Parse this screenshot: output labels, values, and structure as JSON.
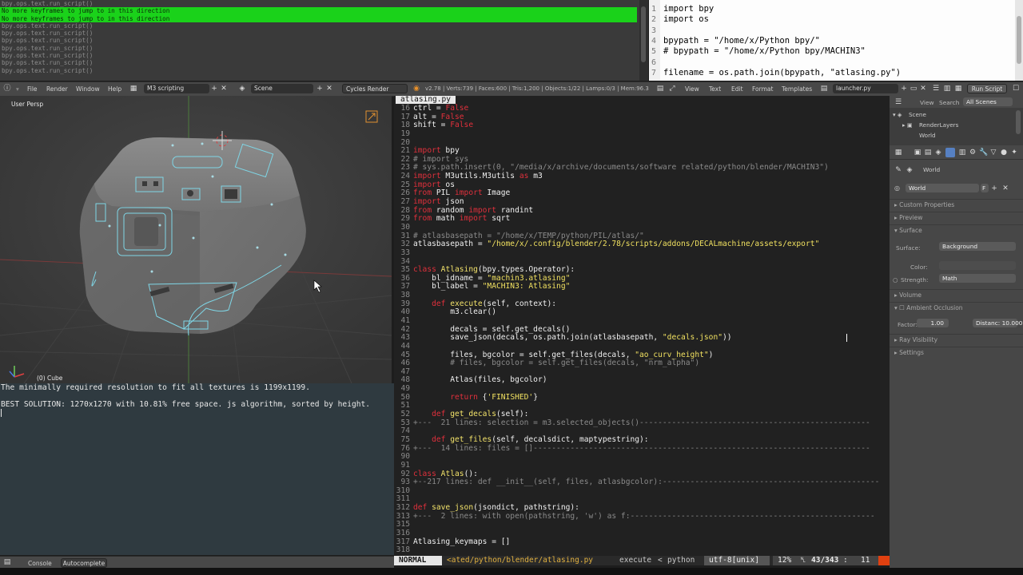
{
  "info_log": {
    "lines": [
      {
        "text": "bpy.ops.text.run_script()",
        "highlight": false
      },
      {
        "text": "No more keyframes to jump to in this direction",
        "highlight": true
      },
      {
        "text": "No more keyframes to jump to in this direction",
        "highlight": true
      },
      {
        "text": "bpy.ops.text.run_script()",
        "highlight": false
      },
      {
        "text": "bpy.ops.text.run_script()",
        "highlight": false
      },
      {
        "text": "bpy.ops.text.run_script()",
        "highlight": false
      },
      {
        "text": "bpy.ops.text.run_script()",
        "highlight": false
      },
      {
        "text": "bpy.ops.text.run_script()",
        "highlight": false
      },
      {
        "text": "bpy.ops.text.run_script()",
        "highlight": false
      },
      {
        "text": "bpy.ops.text.run_script()",
        "highlight": false
      }
    ]
  },
  "top_text_editor": {
    "lines": [
      {
        "num": "1",
        "code": "import bpy"
      },
      {
        "num": "2",
        "code": "import os"
      },
      {
        "num": "3",
        "code": ""
      },
      {
        "num": "4",
        "code": "bpypath = \"/home/x/Python bpy/\""
      },
      {
        "num": "5",
        "code": "# bpypath = \"/home/x/Python bpy/MACHIN3\""
      },
      {
        "num": "6",
        "code": ""
      },
      {
        "num": "7",
        "code": "filename = os.path.join(bpypath, \"atlasing.py\")"
      }
    ]
  },
  "header": {
    "file": "File",
    "render": "Render",
    "window": "Window",
    "help": "Help",
    "screen_layout": "M3 scripting",
    "scene": "Scene",
    "engine": "Cycles Render",
    "stats": "v2.78 | Verts:739 | Faces:600 | Tris:1,200 | Objects:1/22 | Lamps:0/3 | Mem:96.3",
    "view": "View",
    "text": "Text",
    "edit": "Edit",
    "format": "Format",
    "templates": "Templates",
    "text_name": "launcher.py",
    "run_script": "Run Script"
  },
  "viewport": {
    "view_label": "User Persp",
    "object_label": "(0) Cube"
  },
  "console": {
    "lines": [
      "The minimally required resolution to fit all textures is 1199x1199.",
      "",
      "BEST SOLUTION: 1270x1270 with 10.81% free space. js algorithm, sorted by height."
    ],
    "tab_console": "Console",
    "tab_autocomplete": "Autocomplete"
  },
  "editor": {
    "tab": "atlasing.py",
    "lines": [
      {
        "n": "16",
        "t": [
          [
            "tx",
            "ctrl = "
          ],
          [
            "kw",
            "False"
          ]
        ]
      },
      {
        "n": "17",
        "t": [
          [
            "tx",
            "alt = "
          ],
          [
            "kw",
            "False"
          ]
        ]
      },
      {
        "n": "18",
        "t": [
          [
            "tx",
            "shift = "
          ],
          [
            "kw",
            "False"
          ]
        ]
      },
      {
        "n": "19",
        "t": []
      },
      {
        "n": "20",
        "t": []
      },
      {
        "n": "21",
        "t": [
          [
            "kw",
            "import"
          ],
          [
            "tx",
            " bpy"
          ]
        ]
      },
      {
        "n": "22",
        "t": [
          [
            "cm",
            "# import sys"
          ]
        ]
      },
      {
        "n": "23",
        "t": [
          [
            "cm",
            "# sys.path.insert(0, \"/media/x/archive/documents/software related/python/blender/MACHIN3\")"
          ]
        ]
      },
      {
        "n": "24",
        "t": [
          [
            "kw",
            "import"
          ],
          [
            "tx",
            " M3utils.M3utils "
          ],
          [
            "kw",
            "as"
          ],
          [
            "tx",
            " m3"
          ]
        ]
      },
      {
        "n": "25",
        "t": [
          [
            "kw",
            "import"
          ],
          [
            "tx",
            " os"
          ]
        ]
      },
      {
        "n": "26",
        "t": [
          [
            "kw",
            "from"
          ],
          [
            "tx",
            " PIL "
          ],
          [
            "kw",
            "import"
          ],
          [
            "tx",
            " Image"
          ]
        ]
      },
      {
        "n": "27",
        "t": [
          [
            "kw",
            "import"
          ],
          [
            "tx",
            " json"
          ]
        ]
      },
      {
        "n": "28",
        "t": [
          [
            "kw",
            "from"
          ],
          [
            "tx",
            " random "
          ],
          [
            "kw",
            "import"
          ],
          [
            "tx",
            " randint"
          ]
        ]
      },
      {
        "n": "29",
        "t": [
          [
            "kw",
            "from"
          ],
          [
            "tx",
            " math "
          ],
          [
            "kw",
            "import"
          ],
          [
            "tx",
            " sqrt"
          ]
        ]
      },
      {
        "n": "30",
        "t": []
      },
      {
        "n": "31",
        "t": [
          [
            "cm",
            "# atlasbasepath = \"/home/x/TEMP/python/PIL/atlas/\""
          ]
        ]
      },
      {
        "n": "32",
        "t": [
          [
            "tx",
            "atlasbasepath = "
          ],
          [
            "str",
            "\"/home/x/.config/blender/2.78/scripts/addons/DECALmachine/assets/export\""
          ]
        ]
      },
      {
        "n": "33",
        "t": []
      },
      {
        "n": "34",
        "t": []
      },
      {
        "n": "35",
        "t": [
          [
            "kw",
            "class"
          ],
          [
            "tx",
            " "
          ],
          [
            "fn",
            "Atlasing"
          ],
          [
            "tx",
            "(bpy.types.Operator):"
          ]
        ]
      },
      {
        "n": "36",
        "t": [
          [
            "tx",
            "    bl_idname = "
          ],
          [
            "str",
            "\"machin3.atlasing\""
          ]
        ]
      },
      {
        "n": "37",
        "t": [
          [
            "tx",
            "    bl_label = "
          ],
          [
            "str",
            "\"MACHIN3: Atlasing\""
          ]
        ]
      },
      {
        "n": "38",
        "t": []
      },
      {
        "n": "39",
        "t": [
          [
            "tx",
            "    "
          ],
          [
            "kw",
            "def"
          ],
          [
            "tx",
            " "
          ],
          [
            "fn",
            "execute"
          ],
          [
            "tx",
            "(self, context):"
          ]
        ]
      },
      {
        "n": "40",
        "t": [
          [
            "tx",
            "        m3.clear()"
          ]
        ]
      },
      {
        "n": "41",
        "t": []
      },
      {
        "n": "42",
        "t": [
          [
            "tx",
            "        decals = self.get_decals()"
          ]
        ]
      },
      {
        "n": "43",
        "t": [
          [
            "tx",
            "        save_json(decals, os.path.join(atlasbasepath, "
          ],
          [
            "str",
            "\"decals.json\""
          ],
          [
            "tx",
            "))"
          ]
        ]
      },
      {
        "n": "44",
        "t": []
      },
      {
        "n": "45",
        "t": [
          [
            "tx",
            "        files, bgcolor = self.get_files(decals, "
          ],
          [
            "str",
            "\"ao_curv_height\""
          ],
          [
            "tx",
            ")"
          ]
        ]
      },
      {
        "n": "46",
        "t": [
          [
            "cm",
            "        # files, bgcolor = self.get_files(decals, \"nrm_alpha\")"
          ]
        ]
      },
      {
        "n": "47",
        "t": []
      },
      {
        "n": "48",
        "t": [
          [
            "tx",
            "        Atlas(files, bgcolor)"
          ]
        ]
      },
      {
        "n": "49",
        "t": []
      },
      {
        "n": "50",
        "t": [
          [
            "tx",
            "        "
          ],
          [
            "kw",
            "return"
          ],
          [
            "tx",
            " {"
          ],
          [
            "str",
            "'FINISHED'"
          ],
          [
            "tx",
            "}"
          ]
        ]
      },
      {
        "n": "51",
        "t": []
      },
      {
        "n": "52",
        "t": [
          [
            "tx",
            "    "
          ],
          [
            "kw",
            "def"
          ],
          [
            "tx",
            " "
          ],
          [
            "fn",
            "get_decals"
          ],
          [
            "tx",
            "(self):"
          ]
        ]
      },
      {
        "n": "53",
        "t": [
          [
            "fold",
            "+---  21 lines: selection = m3.selected_objects()--------------------------------------------------"
          ]
        ]
      },
      {
        "n": "74",
        "t": []
      },
      {
        "n": "75",
        "t": [
          [
            "tx",
            "    "
          ],
          [
            "kw",
            "def"
          ],
          [
            "tx",
            " "
          ],
          [
            "fn",
            "get_files"
          ],
          [
            "tx",
            "(self, decalsdict, maptypestring):"
          ]
        ]
      },
      {
        "n": "76",
        "t": [
          [
            "fold",
            "+---  14 lines: files = []-------------------------------------------------------------------------"
          ]
        ]
      },
      {
        "n": "90",
        "t": []
      },
      {
        "n": "91",
        "t": []
      },
      {
        "n": "92",
        "t": [
          [
            "kw",
            "class"
          ],
          [
            "tx",
            " "
          ],
          [
            "fn",
            "Atlas"
          ],
          [
            "tx",
            "():"
          ]
        ]
      },
      {
        "n": "93",
        "t": [
          [
            "fold",
            "+--217 lines: def __init__(self, files, atlasbgcolor):-----------------------------------------------"
          ]
        ]
      },
      {
        "n": "310",
        "t": []
      },
      {
        "n": "311",
        "t": []
      },
      {
        "n": "312",
        "t": [
          [
            "kw",
            "def"
          ],
          [
            "tx",
            " "
          ],
          [
            "fn",
            "save_json"
          ],
          [
            "tx",
            "(jsondict, pathstring):"
          ]
        ]
      },
      {
        "n": "313",
        "t": [
          [
            "fold",
            "+---  2 lines: with open(pathstring, 'w') as f:-----------------------------------------------------"
          ]
        ]
      },
      {
        "n": "315",
        "t": []
      },
      {
        "n": "316",
        "t": []
      },
      {
        "n": "317",
        "t": [
          [
            "tx",
            "Atlasing_keymaps = []"
          ]
        ]
      },
      {
        "n": "318",
        "t": []
      }
    ]
  },
  "statusline": {
    "mode": "NORMAL",
    "path": "<ated/python/blender/atlasing.py",
    "execute": "execute",
    "lang": "python",
    "encoding": "utf-8[unix]",
    "percent": "12%",
    "position": "43/343",
    "col": "11"
  },
  "outliner": {
    "view": "View",
    "search": "Search",
    "scope": "All Scenes",
    "scene": "Scene",
    "renderlayers": "RenderLayers",
    "world": "World"
  },
  "properties": {
    "context": "World",
    "world_name": "World",
    "custom_properties": "Custom Properties",
    "preview": "Preview",
    "surface": "Surface",
    "surface_label": "Surface:",
    "surface_value": "Background",
    "color_label": "Color:",
    "strength_label": "Strength:",
    "strength_value": "Math",
    "volume": "Volume",
    "ambient_occlusion": "Ambient Occlusion",
    "factor_label": "Factor:",
    "factor_value": "1.00",
    "distance_label": "Distanc: 10.000",
    "ray_visibility": "Ray Visibility",
    "settings": "Settings"
  }
}
